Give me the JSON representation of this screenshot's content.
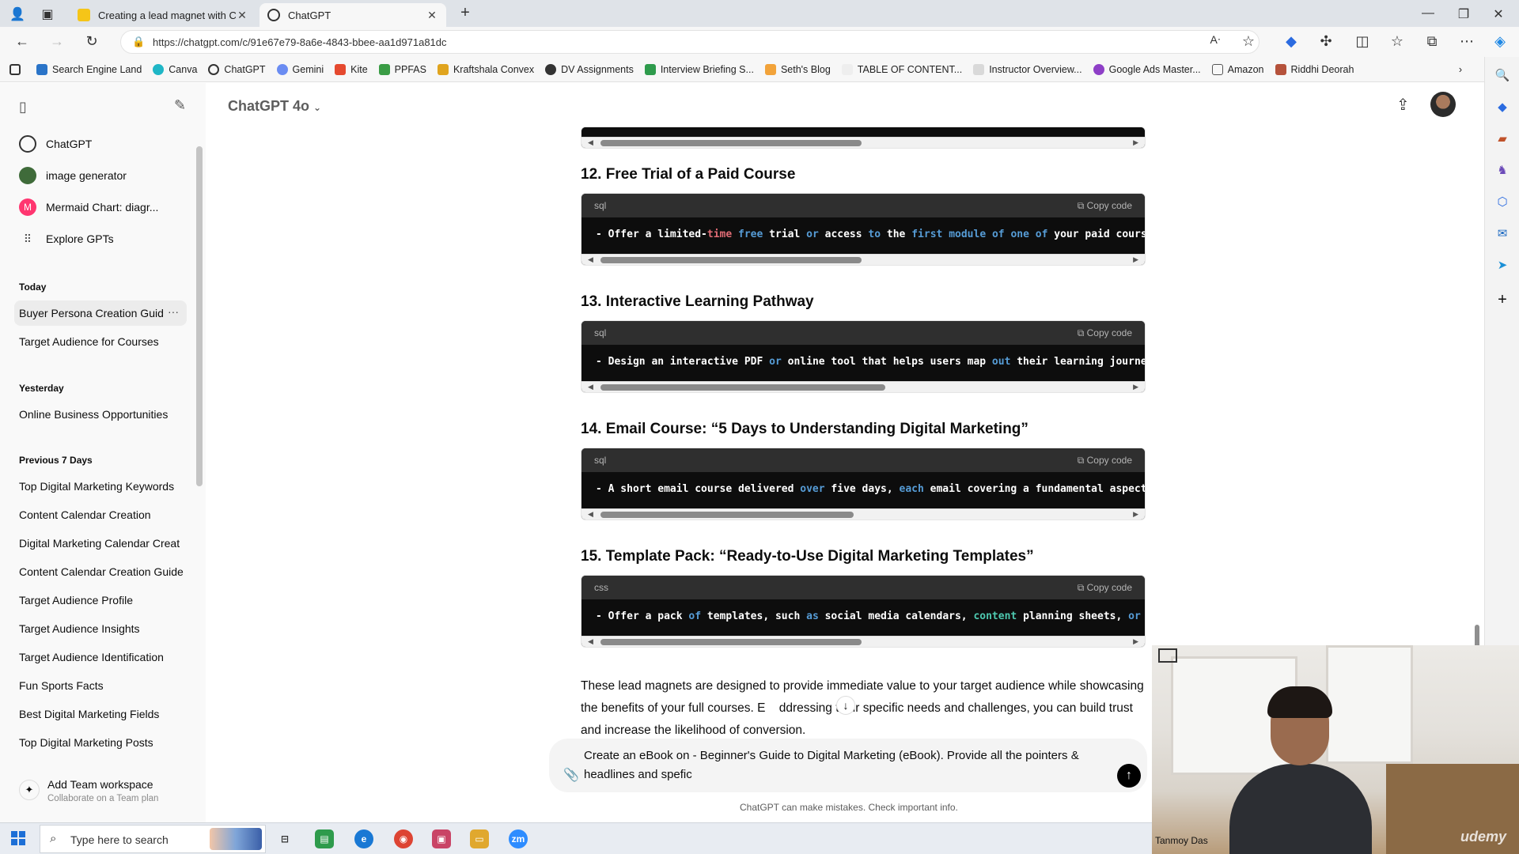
{
  "browser": {
    "tabs": [
      {
        "title": "Creating a lead magnet with Cha",
        "active": false
      },
      {
        "title": "ChatGPT",
        "active": true
      }
    ],
    "url": "https://chatgpt.com/c/91e67e79-8a6e-4843-bbee-aa1d971a81dc",
    "bookmarks": [
      "Search Engine Land",
      "Canva",
      "ChatGPT",
      "Gemini",
      "Kite",
      "PPFAS",
      "Kraftshala Convex",
      "DV Assignments",
      "Interview Briefing S...",
      "Seth's Blog",
      "TABLE OF CONTENT...",
      "Instructor Overview...",
      "Google Ads Master...",
      "Amazon",
      "Riddhi Deorah"
    ]
  },
  "sidebar": {
    "pinned": [
      {
        "label": "ChatGPT",
        "icon": "chatgpt-logo-icon"
      },
      {
        "label": "image generator",
        "icon": "image-generator-icon"
      },
      {
        "label": "Mermaid Chart: diagr...",
        "icon": "mermaid-icon"
      },
      {
        "label": "Explore GPTs",
        "icon": "grid-icon"
      }
    ],
    "sections": [
      {
        "heading": "Today",
        "items": [
          "Buyer Persona Creation Guid",
          "Target Audience for Courses"
        ]
      },
      {
        "heading": "Yesterday",
        "items": [
          "Online Business Opportunities"
        ]
      },
      {
        "heading": "Previous 7 Days",
        "items": [
          "Top Digital Marketing Keywords",
          "Content Calendar Creation",
          "Digital Marketing Calendar Creat",
          "Content Calendar Creation Guide",
          "Target Audience Profile",
          "Target Audience Insights",
          "Target Audience Identification",
          "Fun Sports Facts",
          "Best Digital Marketing Fields",
          "Top Digital Marketing Posts"
        ]
      }
    ],
    "team": {
      "title": "Add Team workspace",
      "subtitle": "Collaborate on a Team plan"
    }
  },
  "header": {
    "model": "ChatGPT 4o"
  },
  "content": {
    "items": [
      {
        "heading": "12. Free Trial of a Paid Course",
        "lang": "sql",
        "copy": "Copy code",
        "code": "- Offer a limited-time free trial or access to the first module of one of your paid course"
      },
      {
        "heading": "13. Interactive Learning Pathway",
        "lang": "sql",
        "copy": "Copy code",
        "code": "- Design an interactive PDF or online tool that helps users map out their learning journey"
      },
      {
        "heading": "14. Email Course: “5 Days to Understanding Digital Marketing”",
        "lang": "sql",
        "copy": "Copy code",
        "code": "- A short email course delivered over five days, each email covering a fundamental aspect"
      },
      {
        "heading": "15. Template Pack: “Ready-to-Use Digital Marketing Templates”",
        "lang": "css",
        "copy": "Copy code",
        "code": "- Offer a pack of templates, such as social media calendars, content planning sheets, or e"
      }
    ],
    "paragraph_a": "These lead magnets are designed to provide immediate value to your target audience while showcasing the benefits of your full courses. E",
    "paragraph_b": "ddressing their specific needs and challenges, you can build trust and increase the likelihood of conversion."
  },
  "composer": {
    "text": "Create an eBook on - Beginner's Guide to Digital Marketing (eBook). Provide all the pointers & headlines and spefic",
    "disclaimer": "ChatGPT can make mistakes. Check important info."
  },
  "webcam": {
    "name": "Tanmoy Das",
    "brand": "udemy"
  },
  "taskbar": {
    "search_placeholder": "Type here to search"
  }
}
